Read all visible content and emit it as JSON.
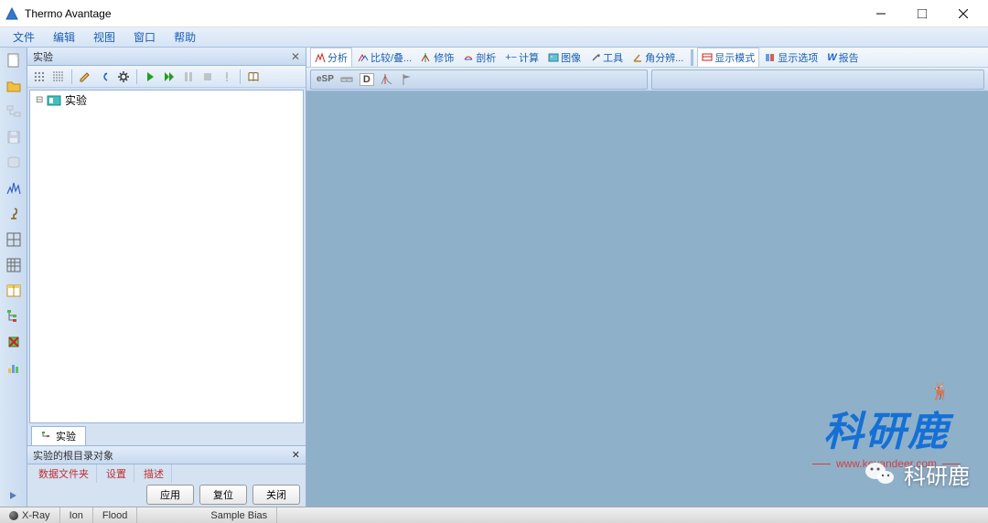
{
  "app": {
    "title": "Thermo Avantage"
  },
  "menu": {
    "file": "文件",
    "edit": "编辑",
    "view": "视图",
    "window": "窗口",
    "help": "帮助"
  },
  "experiment": {
    "panel_title": "实验",
    "tree_root": "实验",
    "tab_label": "实验",
    "root_props_title": "实验的根目录对象",
    "root_tabs": {
      "data_files": "数据文件夹",
      "settings": "设置",
      "description": "描述"
    },
    "buttons": {
      "apply": "应用",
      "reset": "复位",
      "close": "关闭"
    }
  },
  "right_tabs": {
    "analyze": "分析",
    "compare": "比较/叠...",
    "decorate": "修饰",
    "profile": "剖析",
    "calculate": "计算",
    "image": "图像",
    "tools": "工具",
    "angle": "角分辨...",
    "display_mode": "显示模式",
    "display_options": "显示选项",
    "report": "报告"
  },
  "toolbar2": {
    "esp": "eSP",
    "d": "D"
  },
  "status": {
    "xray": "X-Ray",
    "ion": "Ion",
    "flood": "Flood",
    "sample_bias": "Sample Bias"
  },
  "watermark": {
    "text": "科研鹿",
    "url": "www.keyandeer.com",
    "wechat": "科研鹿"
  }
}
